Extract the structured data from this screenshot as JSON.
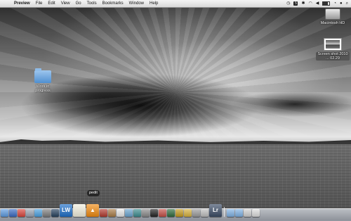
{
  "menubar": {
    "apple_symbol": "",
    "app_name": "Preview",
    "items": [
      "File",
      "Edit",
      "View",
      "Go",
      "Tools",
      "Bookmarks",
      "Window",
      "Help"
    ],
    "status_badge": "5"
  },
  "desktop": {
    "hd_label": "Macintosh HD",
    "screenshot_label": "Screen shot 2010 ... 02.29",
    "folder_label": "Work in progress"
  },
  "dock": {
    "tooltip": "pedit",
    "lw_label": "LW",
    "lr_label": "Lr",
    "vlc_label": "▲",
    "apps": [
      {
        "icon": "finder-icon",
        "color": "#5d9be0"
      },
      {
        "icon": "itunes-icon",
        "color": "#3a6bc2"
      },
      {
        "icon": "chrome-icon",
        "color": "#d9453c"
      },
      {
        "icon": "mail-icon",
        "color": "#9aa4b3"
      },
      {
        "icon": "safari-icon",
        "color": "#4aa0df"
      },
      {
        "icon": "system-preferences-icon",
        "color": "#7d7d7d"
      },
      {
        "icon": "quicktime-icon",
        "color": "#26415e"
      },
      {
        "icon": "lightwave-icon",
        "color": "#1e6fc9"
      },
      {
        "icon": "textedit-icon",
        "color": "#f3f0de"
      },
      {
        "icon": "vlc-icon",
        "color": "#f08a11"
      },
      {
        "icon": "photo-booth-icon",
        "color": "#b23a2e"
      },
      {
        "icon": "address-book-icon",
        "color": "#a87b45"
      },
      {
        "icon": "ical-icon",
        "color": "#e7e7e7"
      },
      {
        "icon": "preview-icon",
        "color": "#6aa4cf"
      },
      {
        "icon": "network-icon",
        "color": "#3c8c8f"
      },
      {
        "icon": "utility-icon",
        "color": "#8a8a8a"
      },
      {
        "icon": "terminal-icon",
        "color": "#222222"
      },
      {
        "icon": "grapher-icon",
        "color": "#c44e45"
      },
      {
        "icon": "activity-icon",
        "color": "#2f6b3d"
      },
      {
        "icon": "ball-icon",
        "color": "#c49a1f"
      },
      {
        "icon": "stickies-icon",
        "color": "#d6b13c"
      },
      {
        "icon": "archive-icon",
        "color": "#9b9b9b"
      },
      {
        "icon": "app-store-icon",
        "color": "#bdbdbd"
      },
      {
        "icon": "lightroom-icon",
        "color": "#3b4c66"
      },
      {
        "icon": "documents-folder-icon",
        "color": "#7fb1e3"
      },
      {
        "icon": "downloads-folder-icon",
        "color": "#7fb1e3"
      },
      {
        "icon": "stack-icon",
        "color": "#cfcfcf"
      },
      {
        "icon": "trash-icon",
        "color": "#dcdcdc"
      }
    ]
  }
}
